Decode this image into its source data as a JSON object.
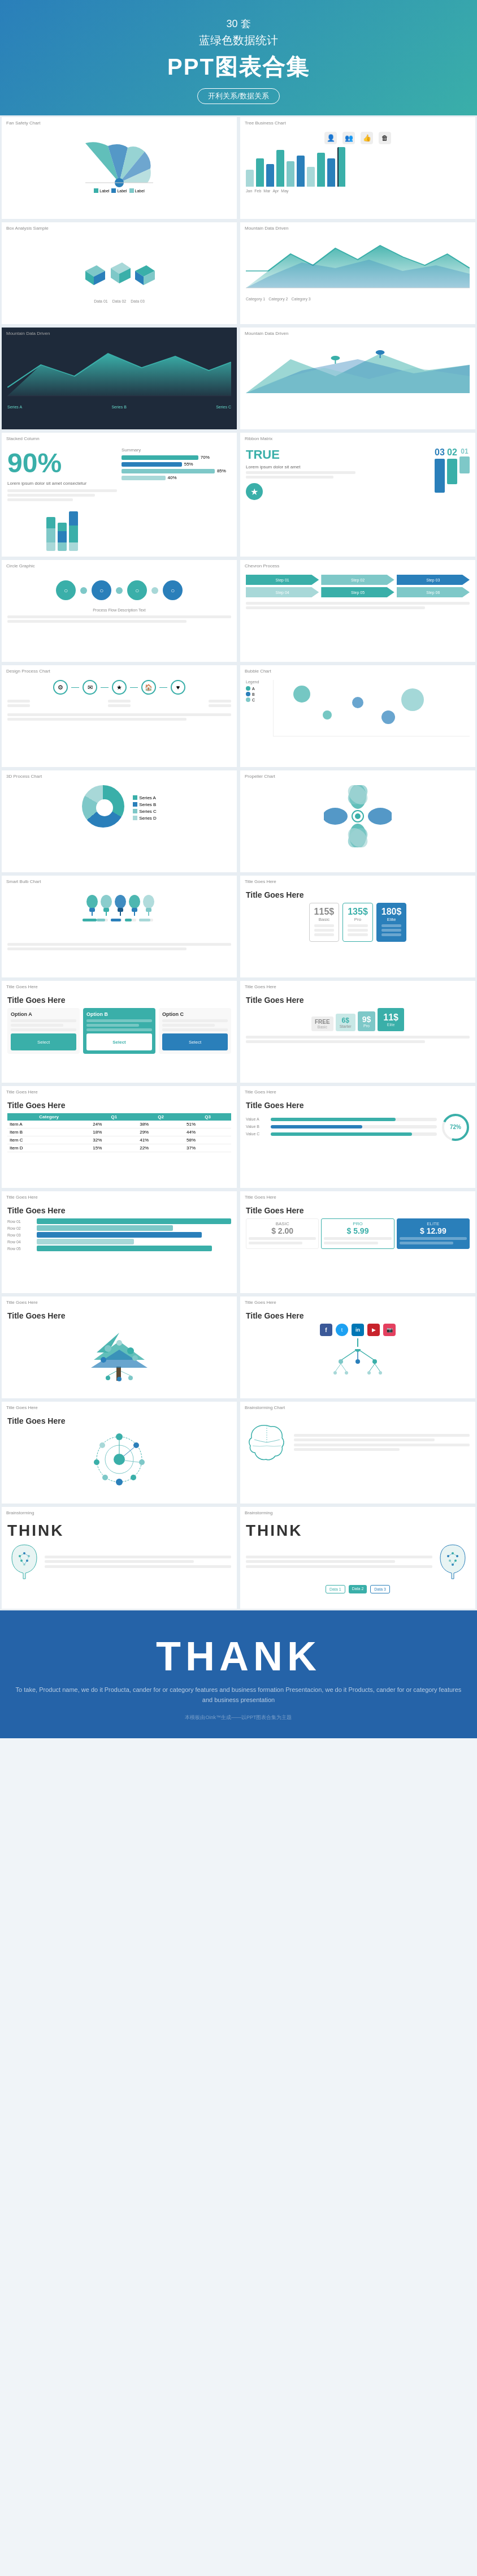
{
  "header": {
    "line1": "30 套",
    "line2": "蓝绿色数据统计",
    "line3": "PPT图表合集",
    "btn": "开利关系/数据关系"
  },
  "slides": [
    {
      "id": "s01",
      "label": "Fan Safety Chart",
      "type": "fan"
    },
    {
      "id": "s02",
      "label": "Tree Business Chart",
      "type": "tree"
    },
    {
      "id": "s03",
      "label": "Box Analysis Sample",
      "type": "box"
    },
    {
      "id": "s04",
      "label": "Mountain Data Driven",
      "type": "mountain1"
    },
    {
      "id": "s05",
      "label": "Mountain Data Driven",
      "type": "mountain2"
    },
    {
      "id": "s06",
      "label": "Mountain Data Driven",
      "type": "mountain3"
    },
    {
      "id": "s07",
      "label": "Stacked Column",
      "type": "stacked",
      "num": "90%"
    },
    {
      "id": "s08",
      "label": "Ribbon Matrix",
      "type": "ribbon"
    },
    {
      "id": "s09",
      "label": "Circle Graphic",
      "type": "circles"
    },
    {
      "id": "s10",
      "label": "Chevron Process",
      "type": "chevron"
    },
    {
      "id": "s11",
      "label": "Design Process Chart",
      "type": "design"
    },
    {
      "id": "s12",
      "label": "Bubble Chart",
      "type": "bubble"
    },
    {
      "id": "s13",
      "label": "3D Process Chart",
      "type": "pie3d"
    },
    {
      "id": "s14",
      "label": "Propeller Chart",
      "type": "propeller"
    },
    {
      "id": "s15",
      "label": "Smart Bulb Chart",
      "type": "bulb"
    },
    {
      "id": "s16",
      "label": "Title Goes Here",
      "type": "price3",
      "prices": [
        "115$",
        "135$",
        "180$"
      ]
    },
    {
      "id": "s17",
      "label": "Title Goes Here",
      "type": "comp1"
    },
    {
      "id": "s18",
      "label": "Title Goes Here",
      "type": "price4",
      "prices": [
        "FREE",
        "6$",
        "9$",
        "11$"
      ]
    },
    {
      "id": "s19",
      "label": "Title Goes Here",
      "type": "table1"
    },
    {
      "id": "s20",
      "label": "Title Goes Here",
      "type": "table2"
    },
    {
      "id": "s21",
      "label": "Title Goes Here",
      "type": "table3"
    },
    {
      "id": "s22",
      "label": "Title Goes Here",
      "type": "table4"
    },
    {
      "id": "s23",
      "label": "Title Goes Here",
      "type": "table5"
    },
    {
      "id": "s24",
      "label": "Title Goes Here",
      "type": "table6"
    },
    {
      "id": "s25",
      "label": "Title Goes Here",
      "type": "tree2"
    },
    {
      "id": "s26",
      "label": "Title Goes Here",
      "type": "social"
    },
    {
      "id": "s27",
      "label": "Title Goes Here",
      "type": "treecirc"
    },
    {
      "id": "s28",
      "label": "Brainstorming Chart",
      "type": "brain1"
    },
    {
      "id": "s29",
      "label": "Brainstorming",
      "type": "think1"
    },
    {
      "id": "s30",
      "label": "Brainstorming",
      "type": "think2"
    },
    {
      "id": "s31",
      "label": "THINK",
      "type": "thinkfull"
    }
  ],
  "footer": {
    "thank": "THANK",
    "sub": "To take, Product name, we do it Producta, cander for or category features and business formation\nPresentacion, we do it Products, cander for or category features and business presentation"
  },
  "colors": {
    "teal": "#3aafa9",
    "blue": "#2a7fba",
    "lteal": "#7ec8c8",
    "darkbg": "#1a2a3a",
    "accent": "#3aafa9"
  }
}
